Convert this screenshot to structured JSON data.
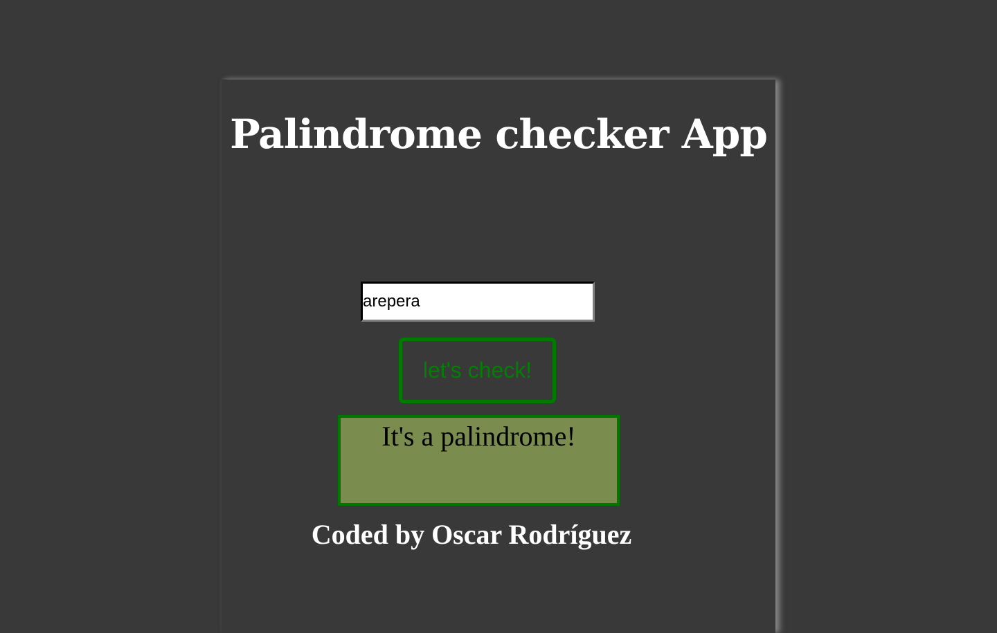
{
  "title": "Palindrome checker App",
  "input": {
    "value": "arepera"
  },
  "check_button_label": "let's check!",
  "result_text": "It's a palindrome!",
  "footer": "Coded by Oscar Rodríguez",
  "colors": {
    "background": "#393939",
    "accent": "#008000",
    "result_bg": "#7a8c4e"
  }
}
